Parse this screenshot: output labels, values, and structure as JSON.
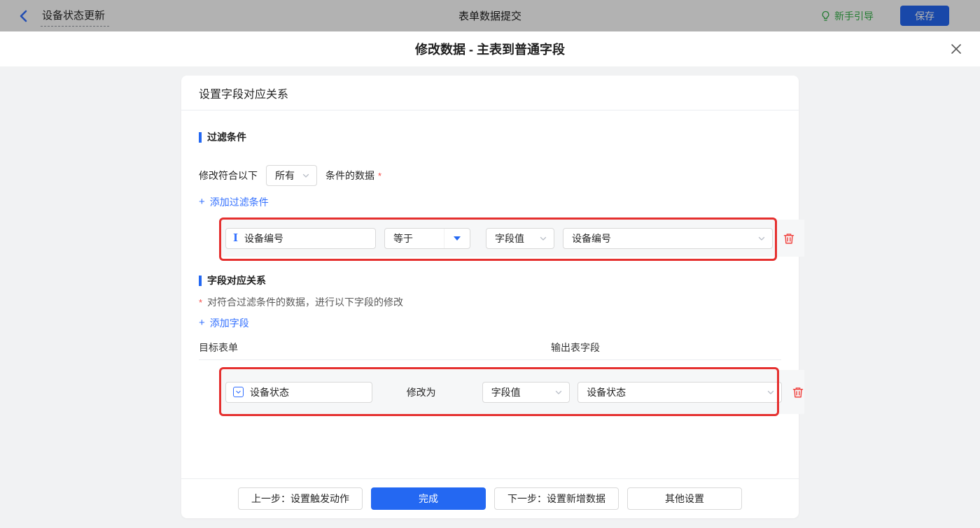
{
  "topbar": {
    "back_title": "设备状态更新",
    "center_title": "表单数据提交",
    "guide_label": "新手引导",
    "save_label": "保存"
  },
  "modal": {
    "title": "修改数据 - 主表到普通字段"
  },
  "card": {
    "header": "设置字段对应关系",
    "filter_section": {
      "title": "过滤条件",
      "match_prefix": "修改符合以下",
      "match_select_value": "所有",
      "match_suffix": "条件的数据",
      "required_mark": "*",
      "add_link": "添加过滤条件",
      "plus": "+",
      "row": {
        "field": "设备编号",
        "operator": "等于",
        "value_type": "字段值",
        "value": "设备编号"
      }
    },
    "mapping_section": {
      "title": "字段对应关系",
      "required_mark": "*",
      "note": "对符合过滤条件的数据，进行以下字段的修改",
      "add_link": "添加字段",
      "plus": "+",
      "col_target": "目标表单",
      "col_output": "输出表字段",
      "row": {
        "field": "设备状态",
        "action": "修改为",
        "value_type": "字段值",
        "value": "设备状态"
      }
    },
    "footer": {
      "prev_label": "上一步：设置触发动作",
      "done_label": "完成",
      "next_label": "下一步：设置新增数据",
      "other_label": "其他设置"
    }
  },
  "colors": {
    "accent_blue": "#2468f2",
    "link_blue": "#3370ff",
    "highlight_red": "#e5302f",
    "guide_green": "#36b24a",
    "danger_red": "#f54a45"
  }
}
